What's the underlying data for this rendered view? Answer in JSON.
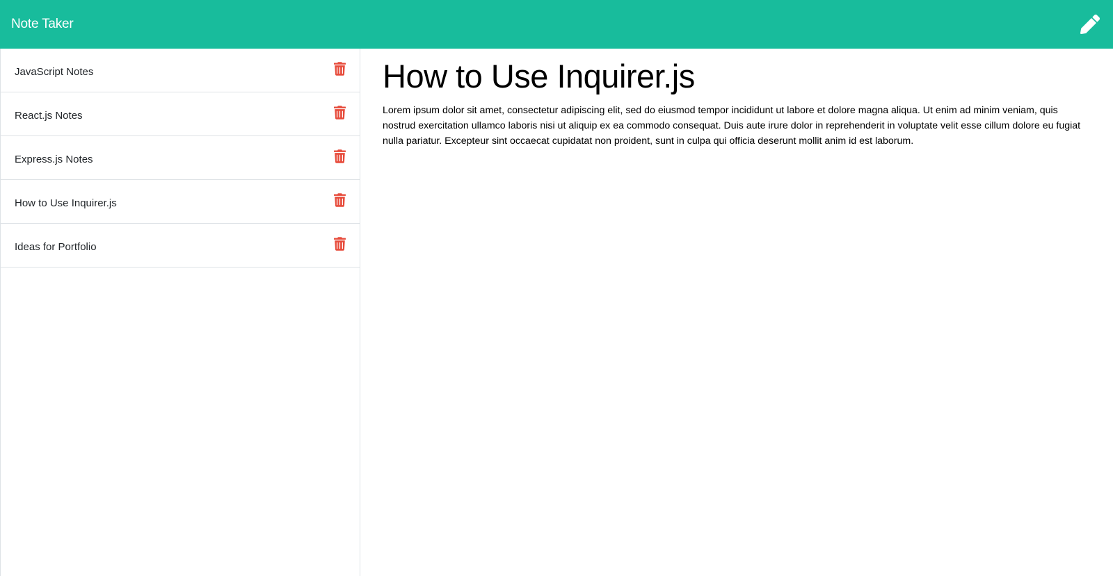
{
  "app": {
    "title": "Note Taker"
  },
  "colors": {
    "navbar": "#18bc9c",
    "trash": "#e74c3c",
    "border": "#dee2e6"
  },
  "icons": {
    "edit": "pencil-icon",
    "delete": "trash-icon"
  },
  "sidebar": {
    "notes": [
      {
        "label": "JavaScript Notes"
      },
      {
        "label": "React.js Notes"
      },
      {
        "label": "Express.js Notes"
      },
      {
        "label": "How to Use Inquirer.js"
      },
      {
        "label": "Ideas for Portfolio"
      }
    ]
  },
  "main": {
    "title": "How to Use Inquirer.js",
    "body": "Lorem ipsum dolor sit amet, consectetur adipiscing elit, sed do eiusmod tempor incididunt ut labore et dolore magna aliqua. Ut enim ad minim veniam, quis nostrud exercitation ullamco laboris nisi ut aliquip ex ea commodo consequat. Duis aute irure dolor in reprehenderit in voluptate velit esse cillum dolore eu fugiat nulla pariatur. Excepteur sint occaecat cupidatat non proident, sunt in culpa qui officia deserunt mollit anim id est laborum."
  }
}
